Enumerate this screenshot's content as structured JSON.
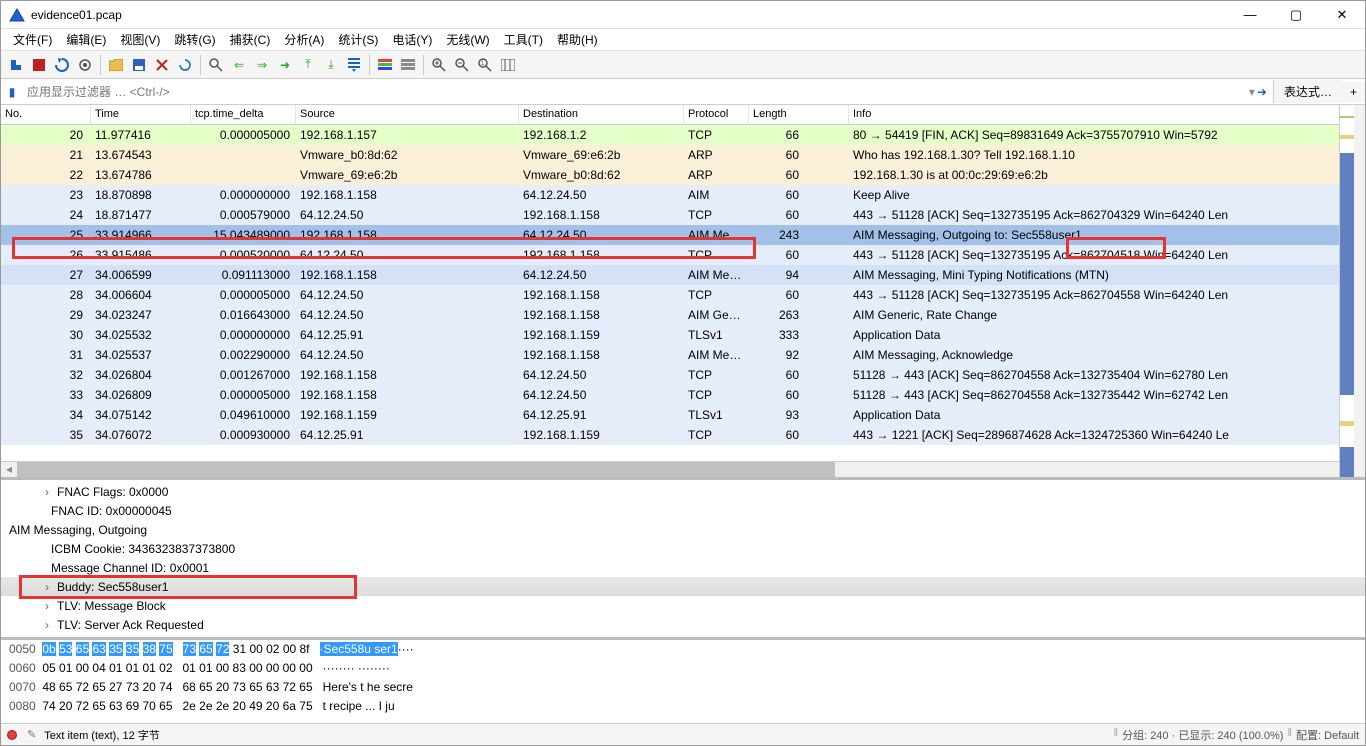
{
  "window": {
    "title": "evidence01.pcap"
  },
  "menu": [
    "文件(F)",
    "编辑(E)",
    "视图(V)",
    "跳转(G)",
    "捕获(C)",
    "分析(A)",
    "统计(S)",
    "电话(Y)",
    "无线(W)",
    "工具(T)",
    "帮助(H)"
  ],
  "filter": {
    "placeholder": "应用显示过滤器 … <Ctrl-/>",
    "expr_btn": "表达式…"
  },
  "columns": [
    "No.",
    "Time",
    "tcp.time_delta",
    "Source",
    "Destination",
    "Protocol",
    "Length",
    "Info"
  ],
  "packets": [
    {
      "no": "20",
      "t": "11.977416",
      "d": "0.000005000",
      "s": "192.168.1.157",
      "dst": "192.168.1.2",
      "p": "TCP",
      "l": "66",
      "i": "80 → 54419 [FIN, ACK] Seq=89831649 Ack=3755707910 Win=5792",
      "cls": "bl-green"
    },
    {
      "no": "21",
      "t": "13.674543",
      "d": "",
      "s": "Vmware_b0:8d:62",
      "dst": "Vmware_69:e6:2b",
      "p": "ARP",
      "l": "60",
      "i": "Who has 192.168.1.30? Tell 192.168.1.10",
      "cls": "bl-yellow"
    },
    {
      "no": "22",
      "t": "13.674786",
      "d": "",
      "s": "Vmware_69:e6:2b",
      "dst": "Vmware_b0:8d:62",
      "p": "ARP",
      "l": "60",
      "i": "192.168.1.30 is at 00:0c:29:69:e6:2b",
      "cls": "bl-yellow"
    },
    {
      "no": "23",
      "t": "18.870898",
      "d": "0.000000000",
      "s": "192.168.1.158",
      "dst": "64.12.24.50",
      "p": "AIM",
      "l": "60",
      "i": "Keep Alive",
      "cls": "bl-blue"
    },
    {
      "no": "24",
      "t": "18.871477",
      "d": "0.000579000",
      "s": "64.12.24.50",
      "dst": "192.168.1.158",
      "p": "TCP",
      "l": "60",
      "i": "443 → 51128 [ACK] Seq=132735195 Ack=862704329 Win=64240 Len",
      "cls": "bl-blue"
    },
    {
      "no": "25",
      "t": "33.914966",
      "d": "15.043489000",
      "s": "192.168.1.158",
      "dst": "64.12.24.50",
      "p": "AIM Me…",
      "l": "243",
      "i": "AIM Messaging, Outgoing to: Sec558user1",
      "cls": "bl-sel2"
    },
    {
      "no": "26",
      "t": "33.915486",
      "d": "0.000520000",
      "s": "64.12.24.50",
      "dst": "192.168.1.158",
      "p": "TCP",
      "l": "60",
      "i": "443 → 51128 [ACK] Seq=132735195 Ack=862704518 Win=64240 Len",
      "cls": "bl-blue"
    },
    {
      "no": "27",
      "t": "34.006599",
      "d": "0.091113000",
      "s": "192.168.1.158",
      "dst": "64.12.24.50",
      "p": "AIM Me…",
      "l": "94",
      "i": "AIM Messaging, Mini Typing Notifications (MTN)",
      "cls": "bl-blue2"
    },
    {
      "no": "28",
      "t": "34.006604",
      "d": "0.000005000",
      "s": "64.12.24.50",
      "dst": "192.168.1.158",
      "p": "TCP",
      "l": "60",
      "i": "443 → 51128 [ACK] Seq=132735195 Ack=862704558 Win=64240 Len",
      "cls": "bl-blue"
    },
    {
      "no": "29",
      "t": "34.023247",
      "d": "0.016643000",
      "s": "64.12.24.50",
      "dst": "192.168.1.158",
      "p": "AIM Ge…",
      "l": "263",
      "i": "AIM Generic, Rate Change",
      "cls": "bl-blue"
    },
    {
      "no": "30",
      "t": "34.025532",
      "d": "0.000000000",
      "s": "64.12.25.91",
      "dst": "192.168.1.159",
      "p": "TLSv1",
      "l": "333",
      "i": "Application Data",
      "cls": "bl-blue"
    },
    {
      "no": "31",
      "t": "34.025537",
      "d": "0.002290000",
      "s": "64.12.24.50",
      "dst": "192.168.1.158",
      "p": "AIM Me…",
      "l": "92",
      "i": "AIM Messaging, Acknowledge",
      "cls": "bl-blue"
    },
    {
      "no": "32",
      "t": "34.026804",
      "d": "0.001267000",
      "s": "192.168.1.158",
      "dst": "64.12.24.50",
      "p": "TCP",
      "l": "60",
      "i": "51128 → 443 [ACK] Seq=862704558 Ack=132735404 Win=62780 Len",
      "cls": "bl-blue"
    },
    {
      "no": "33",
      "t": "34.026809",
      "d": "0.000005000",
      "s": "192.168.1.158",
      "dst": "64.12.24.50",
      "p": "TCP",
      "l": "60",
      "i": "51128 → 443 [ACK] Seq=862704558 Ack=132735442 Win=62742 Len",
      "cls": "bl-blue"
    },
    {
      "no": "34",
      "t": "34.075142",
      "d": "0.049610000",
      "s": "192.168.1.159",
      "dst": "64.12.25.91",
      "p": "TLSv1",
      "l": "93",
      "i": "Application Data",
      "cls": "bl-blue"
    },
    {
      "no": "35",
      "t": "34.076072",
      "d": "0.000930000",
      "s": "64.12.25.91",
      "dst": "192.168.1.159",
      "p": "TCP",
      "l": "60",
      "i": "443 → 1221 [ACK] Seq=2896874628 Ack=1324725360 Win=64240 Le",
      "cls": "bl-blue"
    }
  ],
  "details": [
    {
      "txt": "FNAC Flags: 0x0000",
      "lvl": 1,
      "exp": true
    },
    {
      "txt": "FNAC ID: 0x00000045",
      "lvl": 1
    },
    {
      "txt": "AIM Messaging, Outgoing",
      "lvl": 0,
      "col": true
    },
    {
      "txt": "ICBM Cookie: 3436323837373800",
      "lvl": 1
    },
    {
      "txt": "Message Channel ID: 0x0001",
      "lvl": 1
    },
    {
      "txt": "Buddy: Sec558user1",
      "lvl": 1,
      "exp": true,
      "sel": true
    },
    {
      "txt": "TLV: Message Block",
      "lvl": 1,
      "exp": true
    },
    {
      "txt": "TLV: Server Ack Requested",
      "lvl": 1,
      "exp": true
    }
  ],
  "hex": [
    {
      "off": "0050",
      "b": "0b 53 65 63 35 35 38 75  73 65 72 31 00 02 00 8f",
      "a": "·Sec558u ser1····",
      "sel_b": [
        0,
        11
      ],
      "sel_a": [
        0,
        12
      ]
    },
    {
      "off": "0060",
      "b": "05 01 00 04 01 01 01 02  01 01 00 83 00 00 00 00",
      "a": "········ ········"
    },
    {
      "off": "0070",
      "b": "48 65 72 65 27 73 20 74  68 65 20 73 65 63 72 65",
      "a": "Here's t he secre"
    },
    {
      "off": "0080",
      "b": "74 20 72 65 63 69 70 65  2e 2e 2e 20 49 20 6a 75",
      "a": "t recipe ... I ju"
    }
  ],
  "status": {
    "left": "Text item (text), 12 字节",
    "pkts": "分组: 240 · 已显示: 240 (100.0%)",
    "profile": "配置: Default"
  }
}
